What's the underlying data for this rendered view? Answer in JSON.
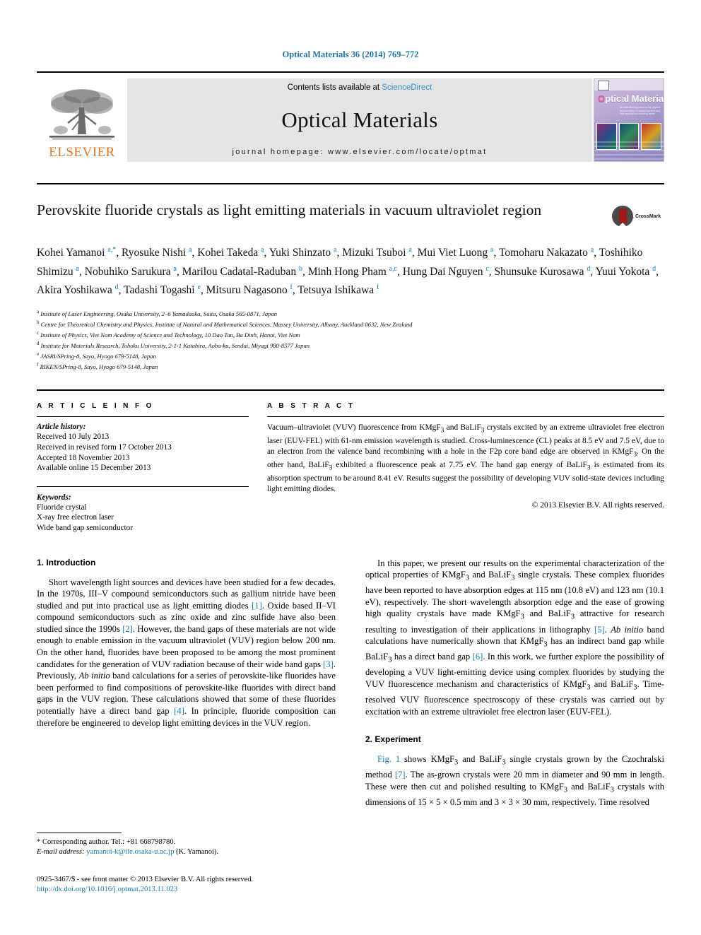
{
  "running_head": "Optical Materials 36 (2014) 769–772",
  "masthead": {
    "publisher": "ELSEVIER",
    "contents_prefix": "Contents lists available at ",
    "contents_link": "ScienceDirect",
    "journal_title": "Optical Materials",
    "homepage": "journal homepage: www.elsevier.com/locate/optmat",
    "cover": {
      "title_part1": "O",
      "title_part2": "ptical Materials",
      "subtitle": "An international journal on the physics and chemistry of optical materials and their applications including lasers"
    }
  },
  "article": {
    "title": "Perovskite fluoride crystals as light emitting materials in vacuum ultraviolet region",
    "crossmark_label": "CrossMark",
    "authors_html": "Kohei Yamanoi <sup>a,</sup><sup class=\"star\">*</sup>, Ryosuke Nishi <sup>a</sup>, Kohei Takeda <sup>a</sup>, Yuki Shinzato <sup>a</sup>, Mizuki Tsuboi <sup>a</sup>, Mui Viet Luong <sup>a</sup>, Tomoharu Nakazato <sup>a</sup>, Toshihiko Shimizu <sup>a</sup>, Nobuhiko Sarukura <sup>a</sup>, Marilou Cadatal-Raduban <sup>b</sup>, Minh Hong Pham <sup>a,c</sup>, Hung Dai Nguyen <sup>c</sup>, Shunsuke Kurosawa <sup>d</sup>, Yuui Yokota <sup>d</sup>, Akira Yoshikawa <sup>d</sup>, Tadashi Togashi <sup>e</sup>, Mitsuru Nagasono <sup>f</sup>, Tetsuya Ishikawa <sup>f</sup>",
    "affiliations": [
      {
        "label": "a",
        "text": "Institute of Laser Engineering, Osaka University, 2–6 Yamadaoka, Suita, Osaka 565-0871, Japan"
      },
      {
        "label": "b",
        "text": "Centre for Theoretical Chemistry and Physics, Institute of Natural and Mathematical Sciences, Massey University, Albany, Auckland 0632, New Zealand"
      },
      {
        "label": "c",
        "text": "Institute of Physics, Viet Nam Academy of Science and Technology, 10 Dao Tan, Ba Dinh, Hanoi, Viet Nam"
      },
      {
        "label": "d",
        "text": "Institute for Materials Research, Tohoku University, 2-1-1 Katahira, Aoba-ku, Sendai, Miyagi 980-8577 Japan"
      },
      {
        "label": "e",
        "text": "JASRI/SPring-8, Sayo, Hyogo 679-5148, Japan"
      },
      {
        "label": "f",
        "text": "RIKEN/SPring-8, Sayo, Hyogo 679-5148, Japan"
      }
    ]
  },
  "article_info": {
    "heading": "A R T I C L E   I N F O",
    "history_title": "Article history:",
    "history": [
      "Received 10 July 2013",
      "Received in revised form 17 October 2013",
      "Accepted 18 November 2013",
      "Available online 15 December 2013"
    ],
    "keywords_title": "Keywords:",
    "keywords": [
      "Fluoride crystal",
      "X-ray free electron laser",
      "Wide band gap semiconductor"
    ]
  },
  "abstract": {
    "heading": "A B S T R A C T",
    "body_html": "Vacuum–ultraviolet (VUV) fluorescence from KMgF<sub>3</sub> and BaLiF<sub>3</sub> crystals excited by an extreme ultraviolet free electron laser (EUV-FEL) with 61-nm emission wavelength is studied. Cross-luminescence (CL) peaks at 8.5 eV and 7.5 eV, due to an electron from the valence band recombining with a hole in the F2p core band edge are observed in KMgF<sub>3</sub>. On the other hand, BaLiF<sub>3</sub> exhibited a fluorescence peak at 7.75 eV. The band gap energy of BaLiF<sub>3</sub> is estimated from its absorption spectrum to be around 8.41 eV. Results suggest the possibility of developing VUV solid-state devices including light emitting diodes.",
    "copyright": "© 2013 Elsevier B.V. All rights reserved."
  },
  "sections": {
    "intro_heading": "1. Introduction",
    "intro_p1_html": "Short wavelength light sources and devices have been studied for a few decades. In the 1970s, III–V compound semiconductors such as gallium nitride have been studied and put into practical use as light emitting diodes <span class=\"ref\">[1]</span>. Oxide based II–VI compound semiconductors such as zinc oxide and zinc sulfide have also been studied since the 1990s <span class=\"ref\">[2]</span>. However, the band gaps of these materials are not wide enough to enable emission in the vacuum ultraviolet (VUV) region below 200 nm. On the other hand, fluorides have been proposed to be among the most prominent candidates for the generation of VUV radiation because of their wide band gaps <span class=\"ref\">[3]</span>. Previously, <i>Ab initio</i> band calculations for a series of perovskite-like fluorides have been performed to find compositions of perovskite-like fluorides with direct band gaps in the VUV region. These calculations showed that some of these fluorides potentially have a direct band gap <span class=\"ref\">[4]</span>. In principle, fluoride composition can therefore be engineered to develop light emitting devices in the VUV region.",
    "right_p1_html": "In this paper, we present our results on the experimental characterization of the optical properties of KMgF<sub>3</sub> and BaLiF<sub>3</sub> single crystals. These complex fluorides have been reported to have absorption edges at 115 nm (10.8 eV) and 123 nm (10.1 eV), respectively. The short wavelength absorption edge and the ease of growing high quality crystals have made KMgF<sub>3</sub> and BaLiF<sub>3</sub> attractive for research resulting to investigation of their applications in lithography <span class=\"ref\">[5]</span>. <i>Ab initio</i> band calculations have numerically shown that KMgF<sub>3</sub> has an indirect band gap while BaLiF<sub>3</sub> has a direct band gap <span class=\"ref\">[6]</span>. In this work, we further explore the possibility of developing a VUV light-emitting device using complex fluorides by studying the VUV fluorescence mechanism and characteristics of KMgF<sub>3</sub> and BaLiF<sub>3</sub>. Time-resolved VUV fluorescence spectroscopy of these crystals was carried out by excitation with an extreme ultraviolet free electron laser (EUV-FEL).",
    "experiment_heading": "2. Experiment",
    "experiment_p1_html": "<span class=\"ref\">Fig. 1</span> shows KMgF<sub>3</sub> and BaLiF<sub>3</sub> single crystals grown by the Czochralski method <span class=\"ref\">[7]</span>. The as-grown crystals were 20 mm in diameter and 90 mm in length. These were then cut and polished resulting to KMgF<sub>3</sub> and BaLiF<sub>3</sub> crystals with dimensions of 15 × 5 × 0.5 mm and 3 × 3 × 30 mm, respectively. Time resolved"
  },
  "footnote": {
    "corresponding_html": "* Corresponding author. Tel.: +81 668798780.",
    "email_label": "E-mail address:",
    "email": "yamanoi-k@ile.osaka-u.ac.jp",
    "email_suffix": "(K. Yamanoi)."
  },
  "colophon": {
    "line1": "0925-3467/$ - see front matter © 2013 Elsevier B.V. All rights reserved.",
    "doi": "http://dx.doi.org/10.1016/j.optmat.2013.11.023"
  },
  "colors": {
    "link_blue": "#1a7aa8",
    "elsevier_orange": "#E87722",
    "band_gray": "#e4e4e4"
  }
}
